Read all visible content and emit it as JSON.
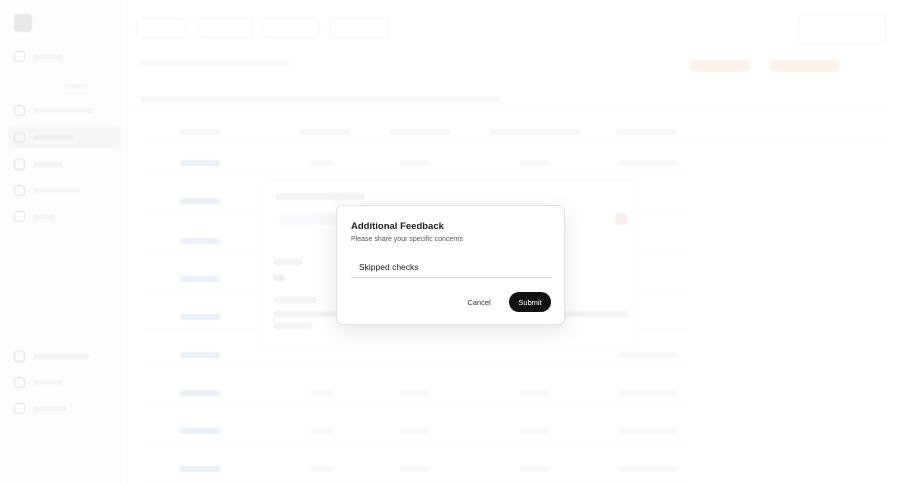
{
  "dialog": {
    "title": "Additional Feedback",
    "subtitle": "Please share your specific concerns",
    "input_value": "Skipped checks",
    "cancel_label": "Cancel",
    "submit_label": "Submit"
  },
  "colors": {
    "submit_bg": "#111111",
    "warning_tint": "#fbe3cf",
    "link_tint": "#cfe0f5"
  }
}
